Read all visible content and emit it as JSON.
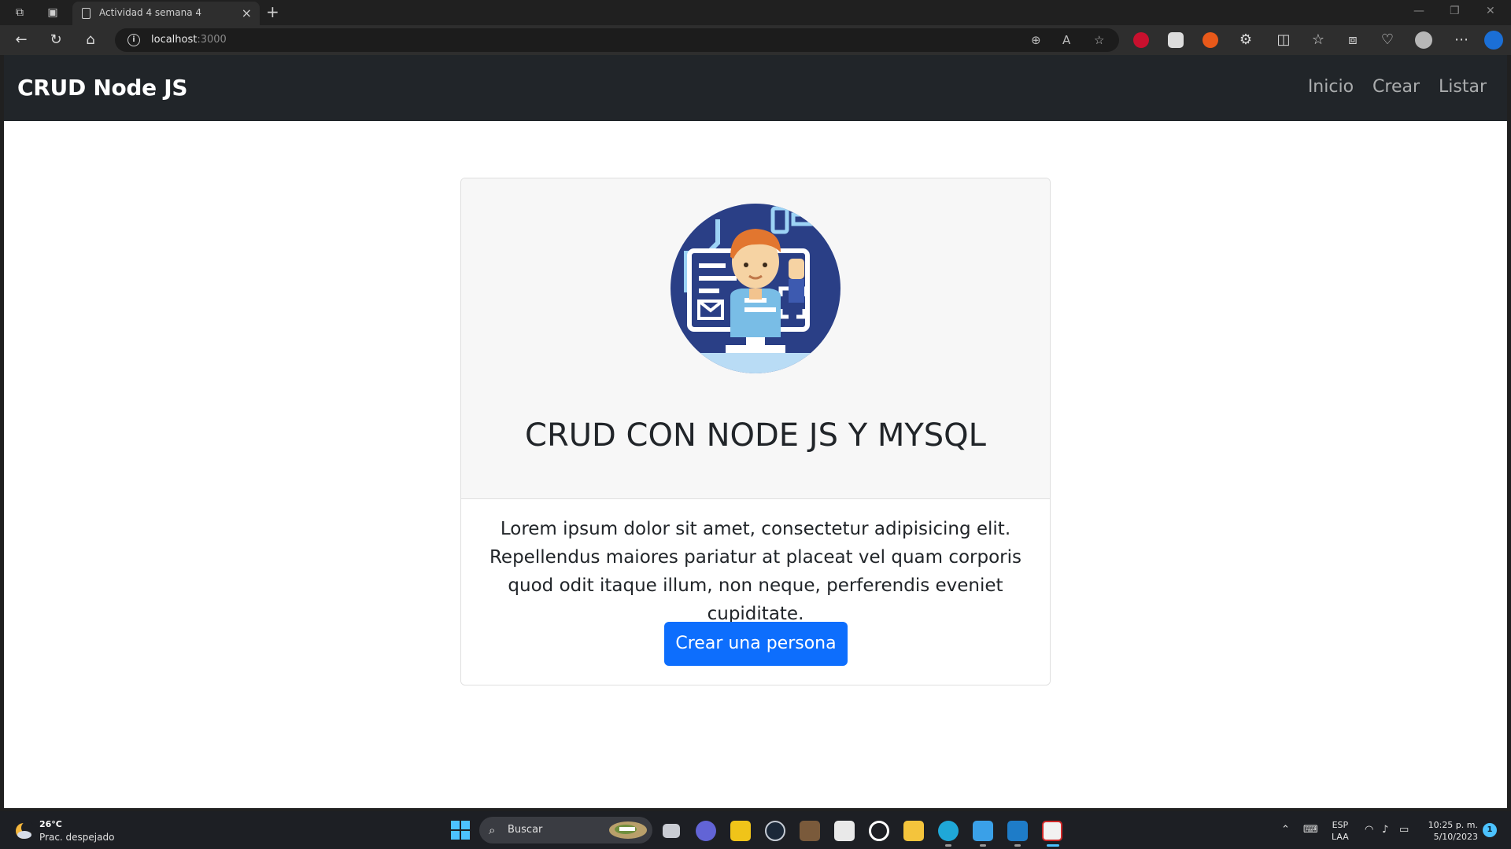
{
  "browser": {
    "tab_title": "Actividad 4 semana 4",
    "url_host": "localhost",
    "url_port": ":3000"
  },
  "navbar": {
    "brand": "CRUD Node JS",
    "links": [
      "Inicio",
      "Crear",
      "Listar"
    ]
  },
  "card": {
    "title": "CRUD CON NODE JS Y MYSQL",
    "text": "Lorem ipsum dolor sit amet, consectetur adipisicing elit. Repellendus maiores pariatur at placeat vel quam corporis quod odit itaque illum, non neque, perferendis eveniet cupiditate.",
    "button": "Crear una persona"
  },
  "taskbar": {
    "weather_temp": "26°C",
    "weather_desc": "Prac. despejado",
    "search_label": "Buscar",
    "lang_1": "ESP",
    "lang_2": "LAA",
    "time": "10:25 p. m.",
    "date": "5/10/2023",
    "notification_count": "1"
  },
  "colors": {
    "navbar_bg": "#212529",
    "primary": "#0d6efd",
    "card_header_bg": "#f7f7f7"
  },
  "icons": [
    "workspaces-icon",
    "tab-actions-icon",
    "back-icon",
    "refresh-icon",
    "home-icon",
    "info-icon",
    "zoom-icon",
    "read-aloud-icon",
    "favorite-icon",
    "split-screen-icon",
    "favorites-icon",
    "collections-icon",
    "health-icon",
    "profile-icon",
    "more-icon",
    "bing-icon",
    "windows-start-icon",
    "search-icon"
  ]
}
